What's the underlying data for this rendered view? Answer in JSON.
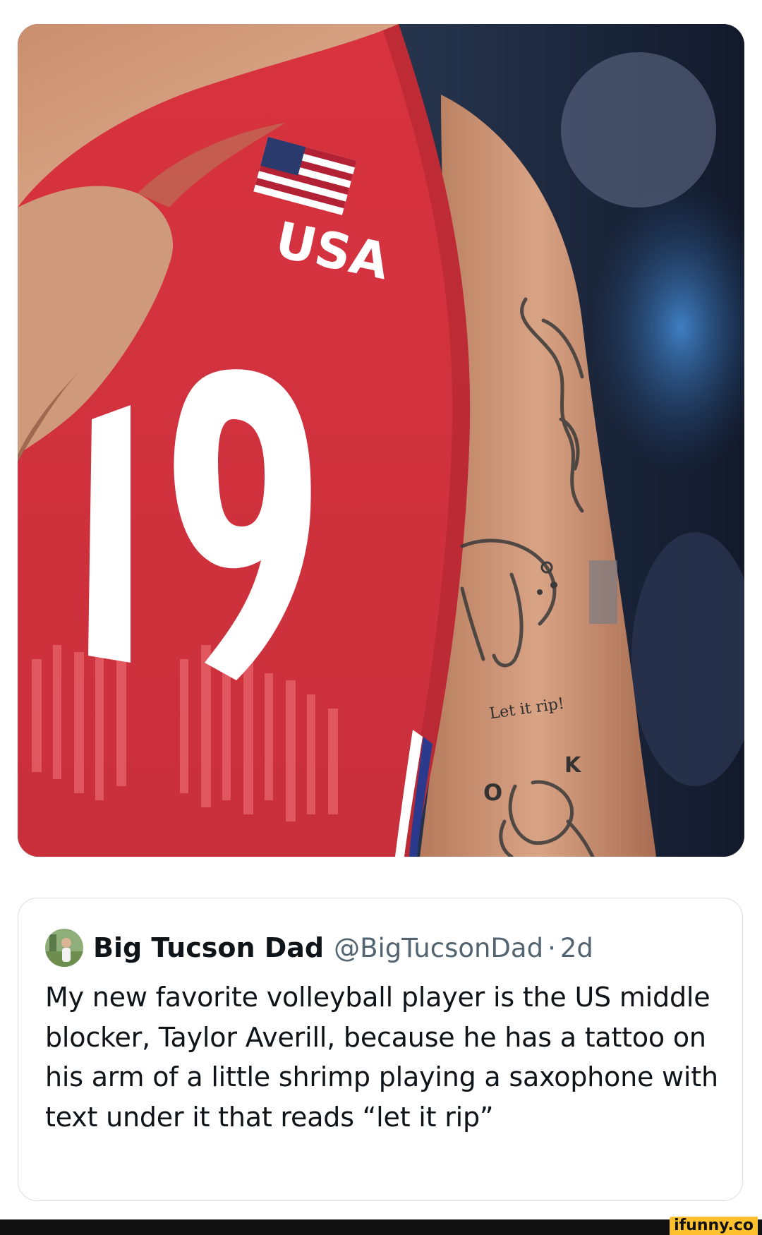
{
  "post": {
    "image": {
      "description_icon": "photo-icon",
      "jersey_text": "USA",
      "jersey_number": "19",
      "tattoo_text": "Let it rip!",
      "tattoo_letters": [
        "O",
        "K"
      ]
    },
    "quoted_tweet": {
      "display_name": "Big Tucson Dad",
      "handle": "@BigTucsonDad",
      "separator": "·",
      "time": "2d",
      "text": "My new favorite volleyball player is the US middle blocker, Taylor Averill, because he has a tattoo on his arm of a little shrimp playing a saxophone with text under it that reads “let it rip”"
    }
  },
  "watermark": "ifunny.co",
  "colors": {
    "jersey_red": "#d8333f",
    "background_blue": "#3f7fc4",
    "text_primary": "#0f1419",
    "text_secondary": "#536471",
    "card_border": "#d9dde1",
    "watermark_bg": "#fec12d",
    "footer_bar": "#111111"
  }
}
